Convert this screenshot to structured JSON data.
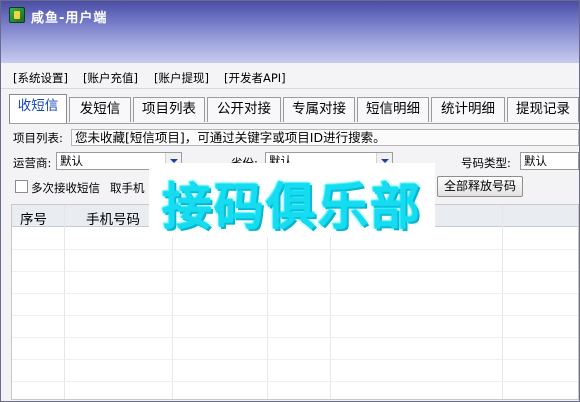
{
  "window": {
    "title": "咸鱼-用户端"
  },
  "menu": [
    "[系统设置]",
    "[账户充值]",
    "[账户提现]",
    "[开发者API]"
  ],
  "tabs": [
    {
      "label": "收短信",
      "active": true
    },
    {
      "label": "发短信"
    },
    {
      "label": "项目列表"
    },
    {
      "label": "公开对接"
    },
    {
      "label": "专属对接"
    },
    {
      "label": "短信明细"
    },
    {
      "label": "统计明细"
    },
    {
      "label": "提现记录"
    }
  ],
  "project": {
    "label": "项目列表:",
    "notice": "您未收藏[短信项目]，可通过关键字或项目ID进行搜索。"
  },
  "filters": {
    "carrier": {
      "label": "运营商:",
      "value": "默认"
    },
    "province": {
      "label": "省份:",
      "value": "默认"
    },
    "number_type": {
      "label": "号码类型:",
      "value": "默认"
    }
  },
  "options": {
    "multi_receive": "多次接收短信",
    "get_phone_button": "取手机",
    "release_all_button": "全部释放号码"
  },
  "table": {
    "columns": [
      "序号",
      "手机号码"
    ]
  },
  "watermark": "接码俱乐部",
  "colors": {
    "accent_tab_text": "#1547b8",
    "title_bar": "#6f74c4",
    "watermark": "#16dcf0"
  }
}
